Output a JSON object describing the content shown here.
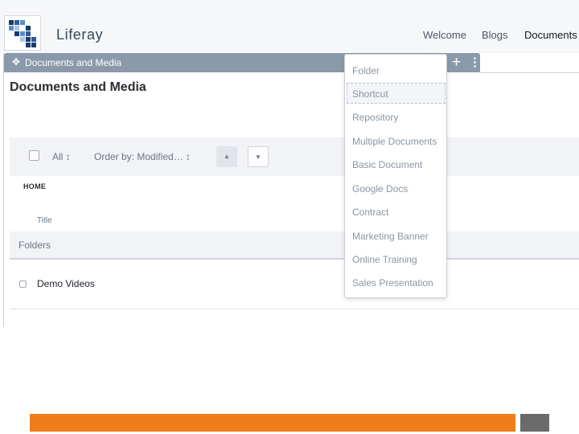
{
  "header": {
    "site_name": "Liferay",
    "nav": [
      "Welcome",
      "Blogs",
      "Documents"
    ],
    "logo_colors": [
      "#1a3a6b",
      "#5b8dc9",
      "#a8c6e8",
      "#2c5aa0"
    ]
  },
  "portlet": {
    "title": "Documents and Media",
    "move_icon": "✥",
    "plus_icon": "+",
    "options_icon": "⋮"
  },
  "main": {
    "heading": "Documents and Media",
    "toolbar": {
      "select_all": "All ↕",
      "order_by": "Order by: Modified… ↕",
      "sort_asc": "▲",
      "sort_desc": "▼"
    },
    "breadcrumb": "HOME",
    "column_title": "Title",
    "section_label": "Folders",
    "folders": [
      "Demo Videos"
    ]
  },
  "dropdown": {
    "items": [
      "Folder",
      "Shortcut",
      "Repository",
      "Multiple Documents",
      "Basic Document",
      "Google Docs",
      "Contract",
      "Marketing Banner",
      "Online Training",
      "Sales Presentation"
    ],
    "highlighted": "Shortcut"
  },
  "colors": {
    "accent_orange": "#ee7d1a",
    "portlet_bar": "#8a9aab",
    "footer_gray": "#6b6b6b"
  }
}
